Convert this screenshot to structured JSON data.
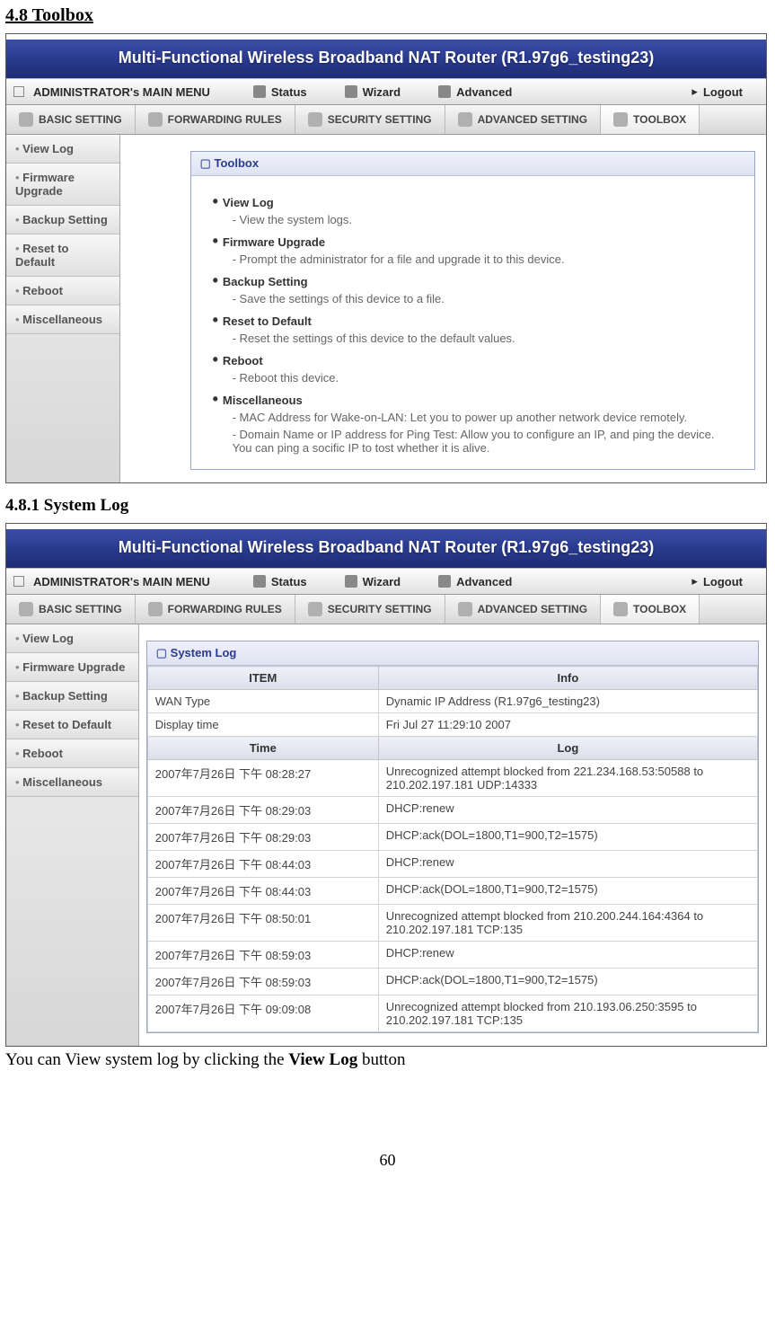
{
  "headings": {
    "section": "4.8 Toolbox",
    "subsection": "4.8.1 System Log"
  },
  "caption": {
    "pre": "You can View system log by clicking the ",
    "strong": "View Log",
    "post": " button"
  },
  "page_number": "60",
  "router_title": "Multi-Functional Wireless Broadband NAT Router (R1.97g6_testing23)",
  "menu": {
    "admin": "ADMINISTRATOR's MAIN MENU",
    "status": "Status",
    "wizard": "Wizard",
    "advanced": "Advanced",
    "logout": "Logout"
  },
  "tabs": {
    "basic": "BASIC SETTING",
    "forwarding": "FORWARDING RULES",
    "security": "SECURITY SETTING",
    "advanced": "ADVANCED SETTING",
    "toolbox": "TOOLBOX"
  },
  "sidebar": {
    "items": [
      "View Log",
      "Firmware Upgrade",
      "Backup Setting",
      "Reset to Default",
      "Reboot",
      "Miscellaneous"
    ]
  },
  "toolbox_panel": {
    "title": "Toolbox",
    "features": [
      {
        "title": "View Log",
        "desc": [
          "View the system logs."
        ]
      },
      {
        "title": "Firmware Upgrade",
        "desc": [
          "Prompt the administrator for a file and upgrade it to this device."
        ]
      },
      {
        "title": "Backup Setting",
        "desc": [
          "Save the settings of this device to a file."
        ]
      },
      {
        "title": "Reset to Default",
        "desc": [
          "Reset the settings of this device to the default values."
        ]
      },
      {
        "title": "Reboot",
        "desc": [
          "Reboot this device."
        ]
      },
      {
        "title": "Miscellaneous",
        "desc": [
          "MAC Address for Wake-on-LAN: Let you to power up another network device remotely.",
          "Domain Name or IP address for Ping Test: Allow you to configure an IP, and ping the device. You can ping a socific IP to tost whether it is alive."
        ]
      }
    ]
  },
  "syslog_panel": {
    "title": "System Log",
    "header1": {
      "item": "ITEM",
      "info": "Info"
    },
    "info_rows": [
      {
        "k": "WAN Type",
        "v": "Dynamic IP Address (R1.97g6_testing23)"
      },
      {
        "k": "Display time",
        "v": "Fri Jul 27 11:29:10 2007"
      }
    ],
    "header2": {
      "time": "Time",
      "log": "Log"
    },
    "log_rows": [
      {
        "t": "2007年7月26日 下午 08:28:27",
        "l": "Unrecognized attempt blocked from 221.234.168.53:50588 to 210.202.197.181 UDP:14333"
      },
      {
        "t": "2007年7月26日 下午 08:29:03",
        "l": "DHCP:renew"
      },
      {
        "t": "2007年7月26日 下午 08:29:03",
        "l": "DHCP:ack(DOL=1800,T1=900,T2=1575)"
      },
      {
        "t": "2007年7月26日 下午 08:44:03",
        "l": "DHCP:renew"
      },
      {
        "t": "2007年7月26日 下午 08:44:03",
        "l": "DHCP:ack(DOL=1800,T1=900,T2=1575)"
      },
      {
        "t": "2007年7月26日 下午 08:50:01",
        "l": "Unrecognized attempt blocked from 210.200.244.164:4364 to 210.202.197.181 TCP:135"
      },
      {
        "t": "2007年7月26日 下午 08:59:03",
        "l": "DHCP:renew"
      },
      {
        "t": "2007年7月26日 下午 08:59:03",
        "l": "DHCP:ack(DOL=1800,T1=900,T2=1575)"
      },
      {
        "t": "2007年7月26日 下午 09:09:08",
        "l": "Unrecognized attempt blocked from 210.193.06.250:3595 to 210.202.197.181 TCP:135"
      }
    ]
  }
}
